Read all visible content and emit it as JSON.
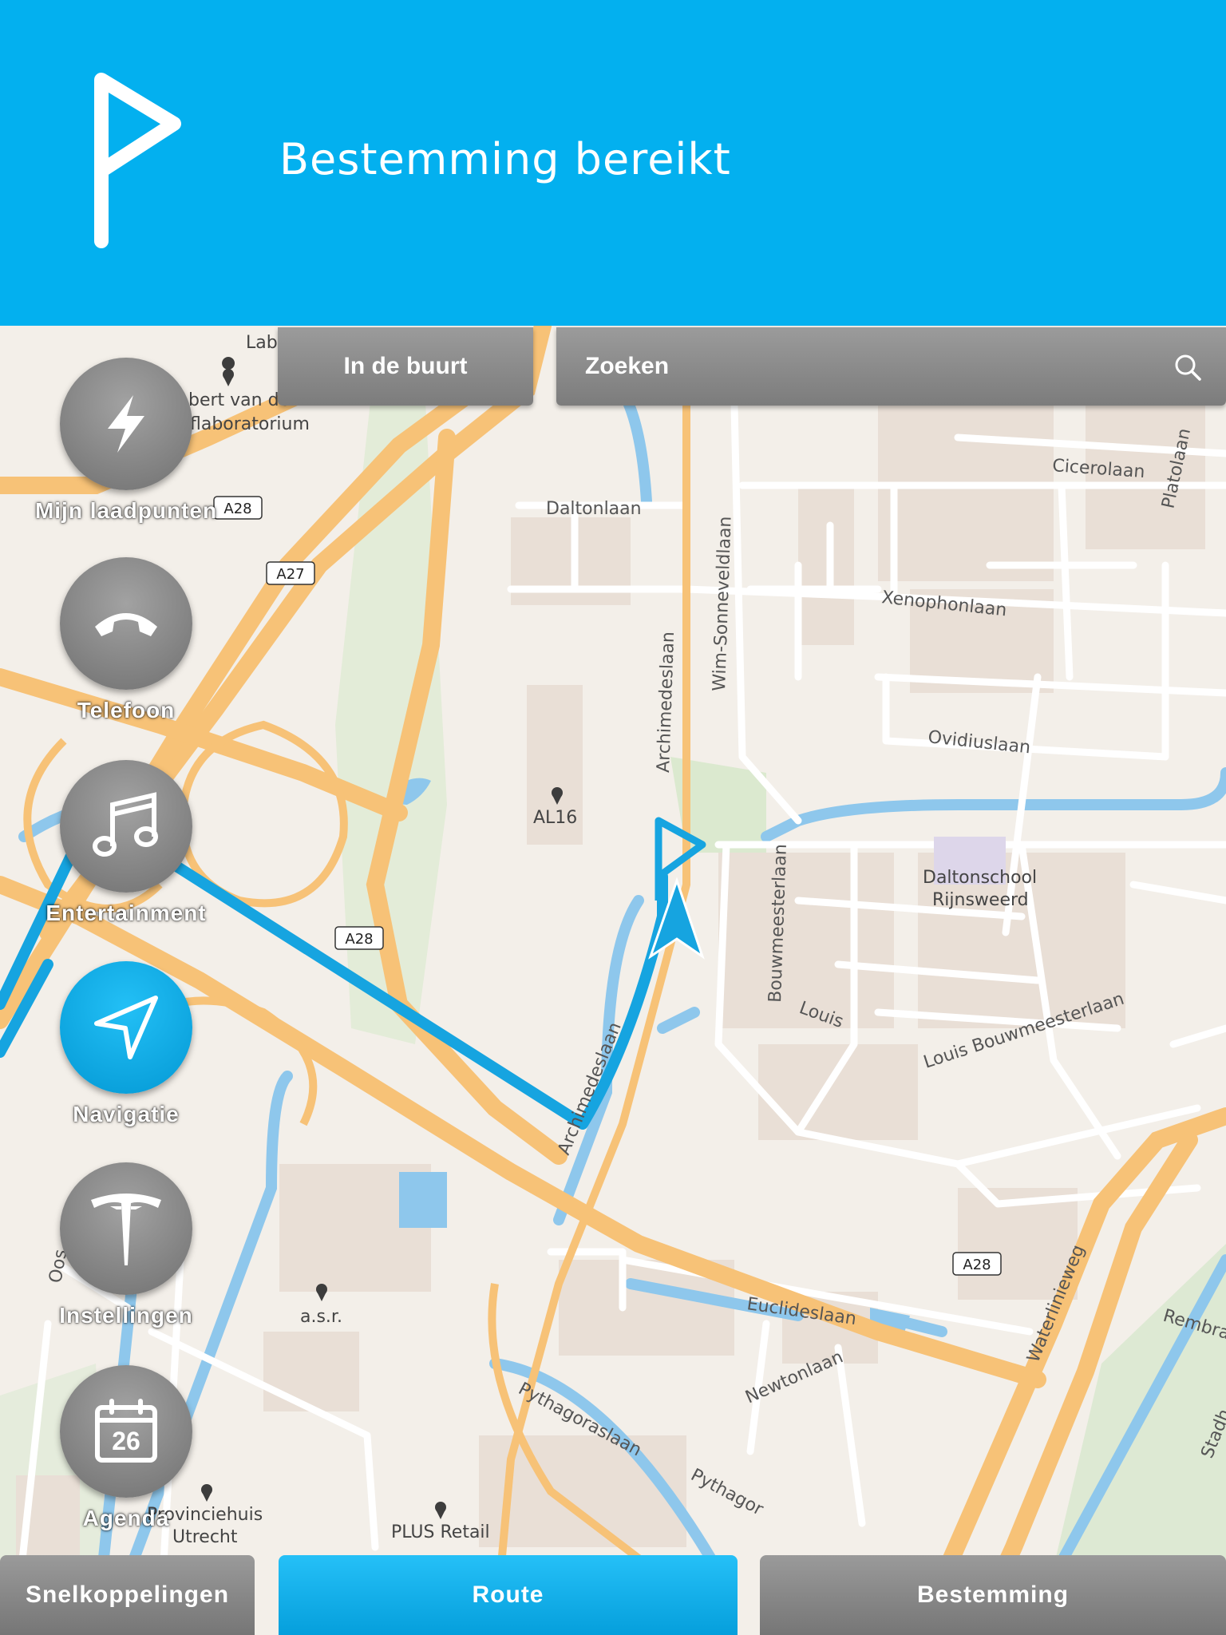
{
  "banner": {
    "title": "Bestemming bereikt",
    "icon": "destination-flag-icon",
    "color": "#03b0ef"
  },
  "top_buttons": {
    "nearby": "In de buurt",
    "search": "Zoeken"
  },
  "sidebar": {
    "items": [
      {
        "label": "Mijn laadpunten",
        "icon": "lightning-icon"
      },
      {
        "label": "Telefoon",
        "icon": "phone-icon"
      },
      {
        "label": "Entertainment",
        "icon": "music-note-icon"
      },
      {
        "label": "Navigatie",
        "icon": "navigation-arrow-icon",
        "active": true
      },
      {
        "label": "Instellingen",
        "icon": "tesla-logo-icon"
      },
      {
        "label": "Agenda",
        "icon": "calendar-icon",
        "day": "26"
      }
    ]
  },
  "bottom_tabs": {
    "shortcuts": "Snelkoppelingen",
    "route": "Route",
    "destination": "Bestemming"
  },
  "map": {
    "route_color": "#16a4e0",
    "streets": [
      "Cicerolaan",
      "Platolaan",
      "Daltonlaan",
      "Xenophonlaan",
      "Wim-Sonneveldlaan",
      "Archimedeslaan",
      "Ovidiuslaan",
      "Louis Bouwmeesterlaan",
      "Louis",
      "Bouwmeesterlaan",
      "Euclideslaan",
      "Newtonlaan",
      "Pythagoraslaan",
      "Pythagor",
      "Waterlinieweg",
      "Rembra",
      "Stadh",
      "Oos",
      "Archimedeslaan"
    ],
    "pois": [
      "bert van de",
      "flaboratorium",
      "Lab",
      "AL16",
      "Daltonschool",
      "Rijnsweerd",
      "a.s.r.",
      "Provinciehuis",
      "Utrecht",
      "PLUS Retail"
    ],
    "highway_shields": [
      "A28",
      "A27",
      "A28",
      "A28"
    ]
  }
}
